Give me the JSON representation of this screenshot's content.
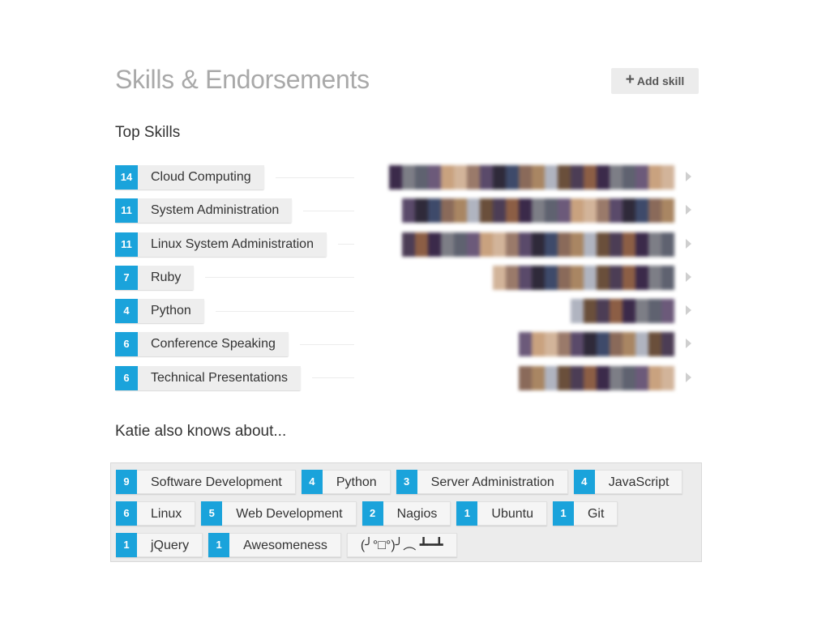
{
  "header": {
    "title": "Skills & Endorsements",
    "add_skill_label": "Add skill"
  },
  "top_skills": {
    "heading": "Top Skills",
    "items": [
      {
        "count": "14",
        "name": "Cloud Computing",
        "endorser_count": 22
      },
      {
        "count": "11",
        "name": "System Administration",
        "endorser_count": 21
      },
      {
        "count": "11",
        "name": "Linux System Administration",
        "endorser_count": 21
      },
      {
        "count": "7",
        "name": "Ruby",
        "endorser_count": 14
      },
      {
        "count": "4",
        "name": "Python",
        "endorser_count": 8
      },
      {
        "count": "6",
        "name": "Conference Speaking",
        "endorser_count": 12
      },
      {
        "count": "6",
        "name": "Technical Presentations",
        "endorser_count": 12
      }
    ]
  },
  "also_knows": {
    "heading": "Katie also knows about...",
    "rows": [
      [
        {
          "count": "9",
          "name": "Software Development"
        },
        {
          "count": "4",
          "name": "Python"
        },
        {
          "count": "3",
          "name": "Server Administration"
        },
        {
          "count": "4",
          "name": "JavaScript"
        }
      ],
      [
        {
          "count": "6",
          "name": "Linux"
        },
        {
          "count": "5",
          "name": "Web Development"
        },
        {
          "count": "2",
          "name": "Nagios"
        },
        {
          "count": "1",
          "name": "Ubuntu"
        },
        {
          "count": "1",
          "name": "Git"
        }
      ],
      [
        {
          "count": "1",
          "name": "jQuery"
        },
        {
          "count": "1",
          "name": "Awesomeness"
        },
        {
          "count": "",
          "name": "(╯°□°)╯︵ ┻━┻"
        }
      ]
    ]
  },
  "colors": {
    "count_badge": "#1aa3db",
    "title": "#a9a9a9",
    "pill_bg": "#eeeeee",
    "also_box_bg": "#ececec"
  },
  "icons": {
    "add": "plus-icon",
    "row_expand": "chevron-right-icon",
    "endorsers": "avatar-strip (blurred)"
  }
}
